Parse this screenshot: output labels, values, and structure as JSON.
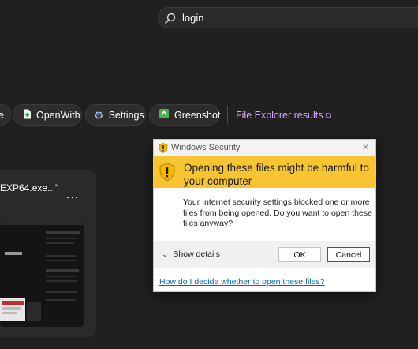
{
  "search": {
    "query": "login"
  },
  "filters": {
    "partial_label": "e",
    "items": [
      {
        "label": "OpenWith",
        "icon": "openwith-icon"
      },
      {
        "label": "Settings",
        "icon": "gear-icon"
      },
      {
        "label": "Greenshot",
        "icon": "greenshot-icon"
      }
    ],
    "file_explorer_link": "File Explorer results"
  },
  "result_card": {
    "title": "EXP64.exe...\"",
    "more": "..."
  },
  "dialog": {
    "window_title": "Windows Security",
    "heading": "Opening these files might be harmful to your computer",
    "body": "Your Internet security settings blocked one or more files from being opened. Do you want to open these files anyway?",
    "show_details": "Show details",
    "ok": "OK",
    "cancel": "Cancel",
    "help_link": "How do I decide whether to open these files?"
  },
  "colors": {
    "background": "#202020",
    "warning_banner": "#f7c531",
    "link_purple": "#d7a6ff",
    "link_blue": "#0067c0"
  }
}
